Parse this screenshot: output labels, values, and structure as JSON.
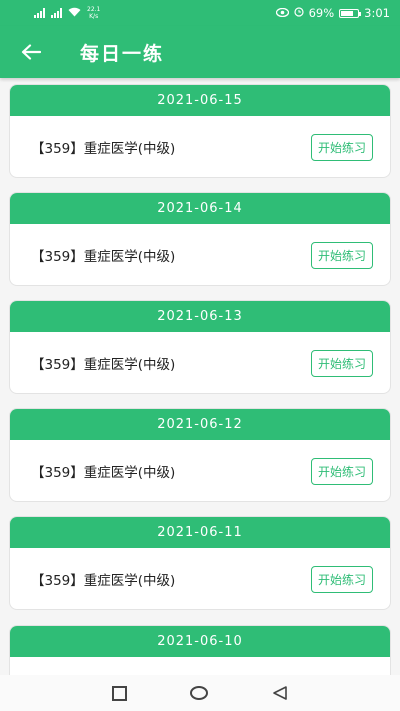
{
  "status_bar": {
    "net_speed_value": "22.1",
    "net_speed_unit": "K/s",
    "battery": "69%",
    "time": "3:01"
  },
  "app_bar": {
    "title": "每日一练"
  },
  "items": [
    {
      "date": "2021-06-15",
      "name": "【359】重症医学(中级)",
      "button": "开始练习"
    },
    {
      "date": "2021-06-14",
      "name": "【359】重症医学(中级)",
      "button": "开始练习"
    },
    {
      "date": "2021-06-13",
      "name": "【359】重症医学(中级)",
      "button": "开始练习"
    },
    {
      "date": "2021-06-12",
      "name": "【359】重症医学(中级)",
      "button": "开始练习"
    },
    {
      "date": "2021-06-11",
      "name": "【359】重症医学(中级)",
      "button": "开始练习"
    },
    {
      "date": "2021-06-10"
    }
  ],
  "colors": {
    "accent": "#2fbd76"
  },
  "icons": {
    "back": "arrow-left-icon",
    "nav": [
      "square-recents-icon",
      "circle-home-icon",
      "triangle-back-icon"
    ]
  }
}
